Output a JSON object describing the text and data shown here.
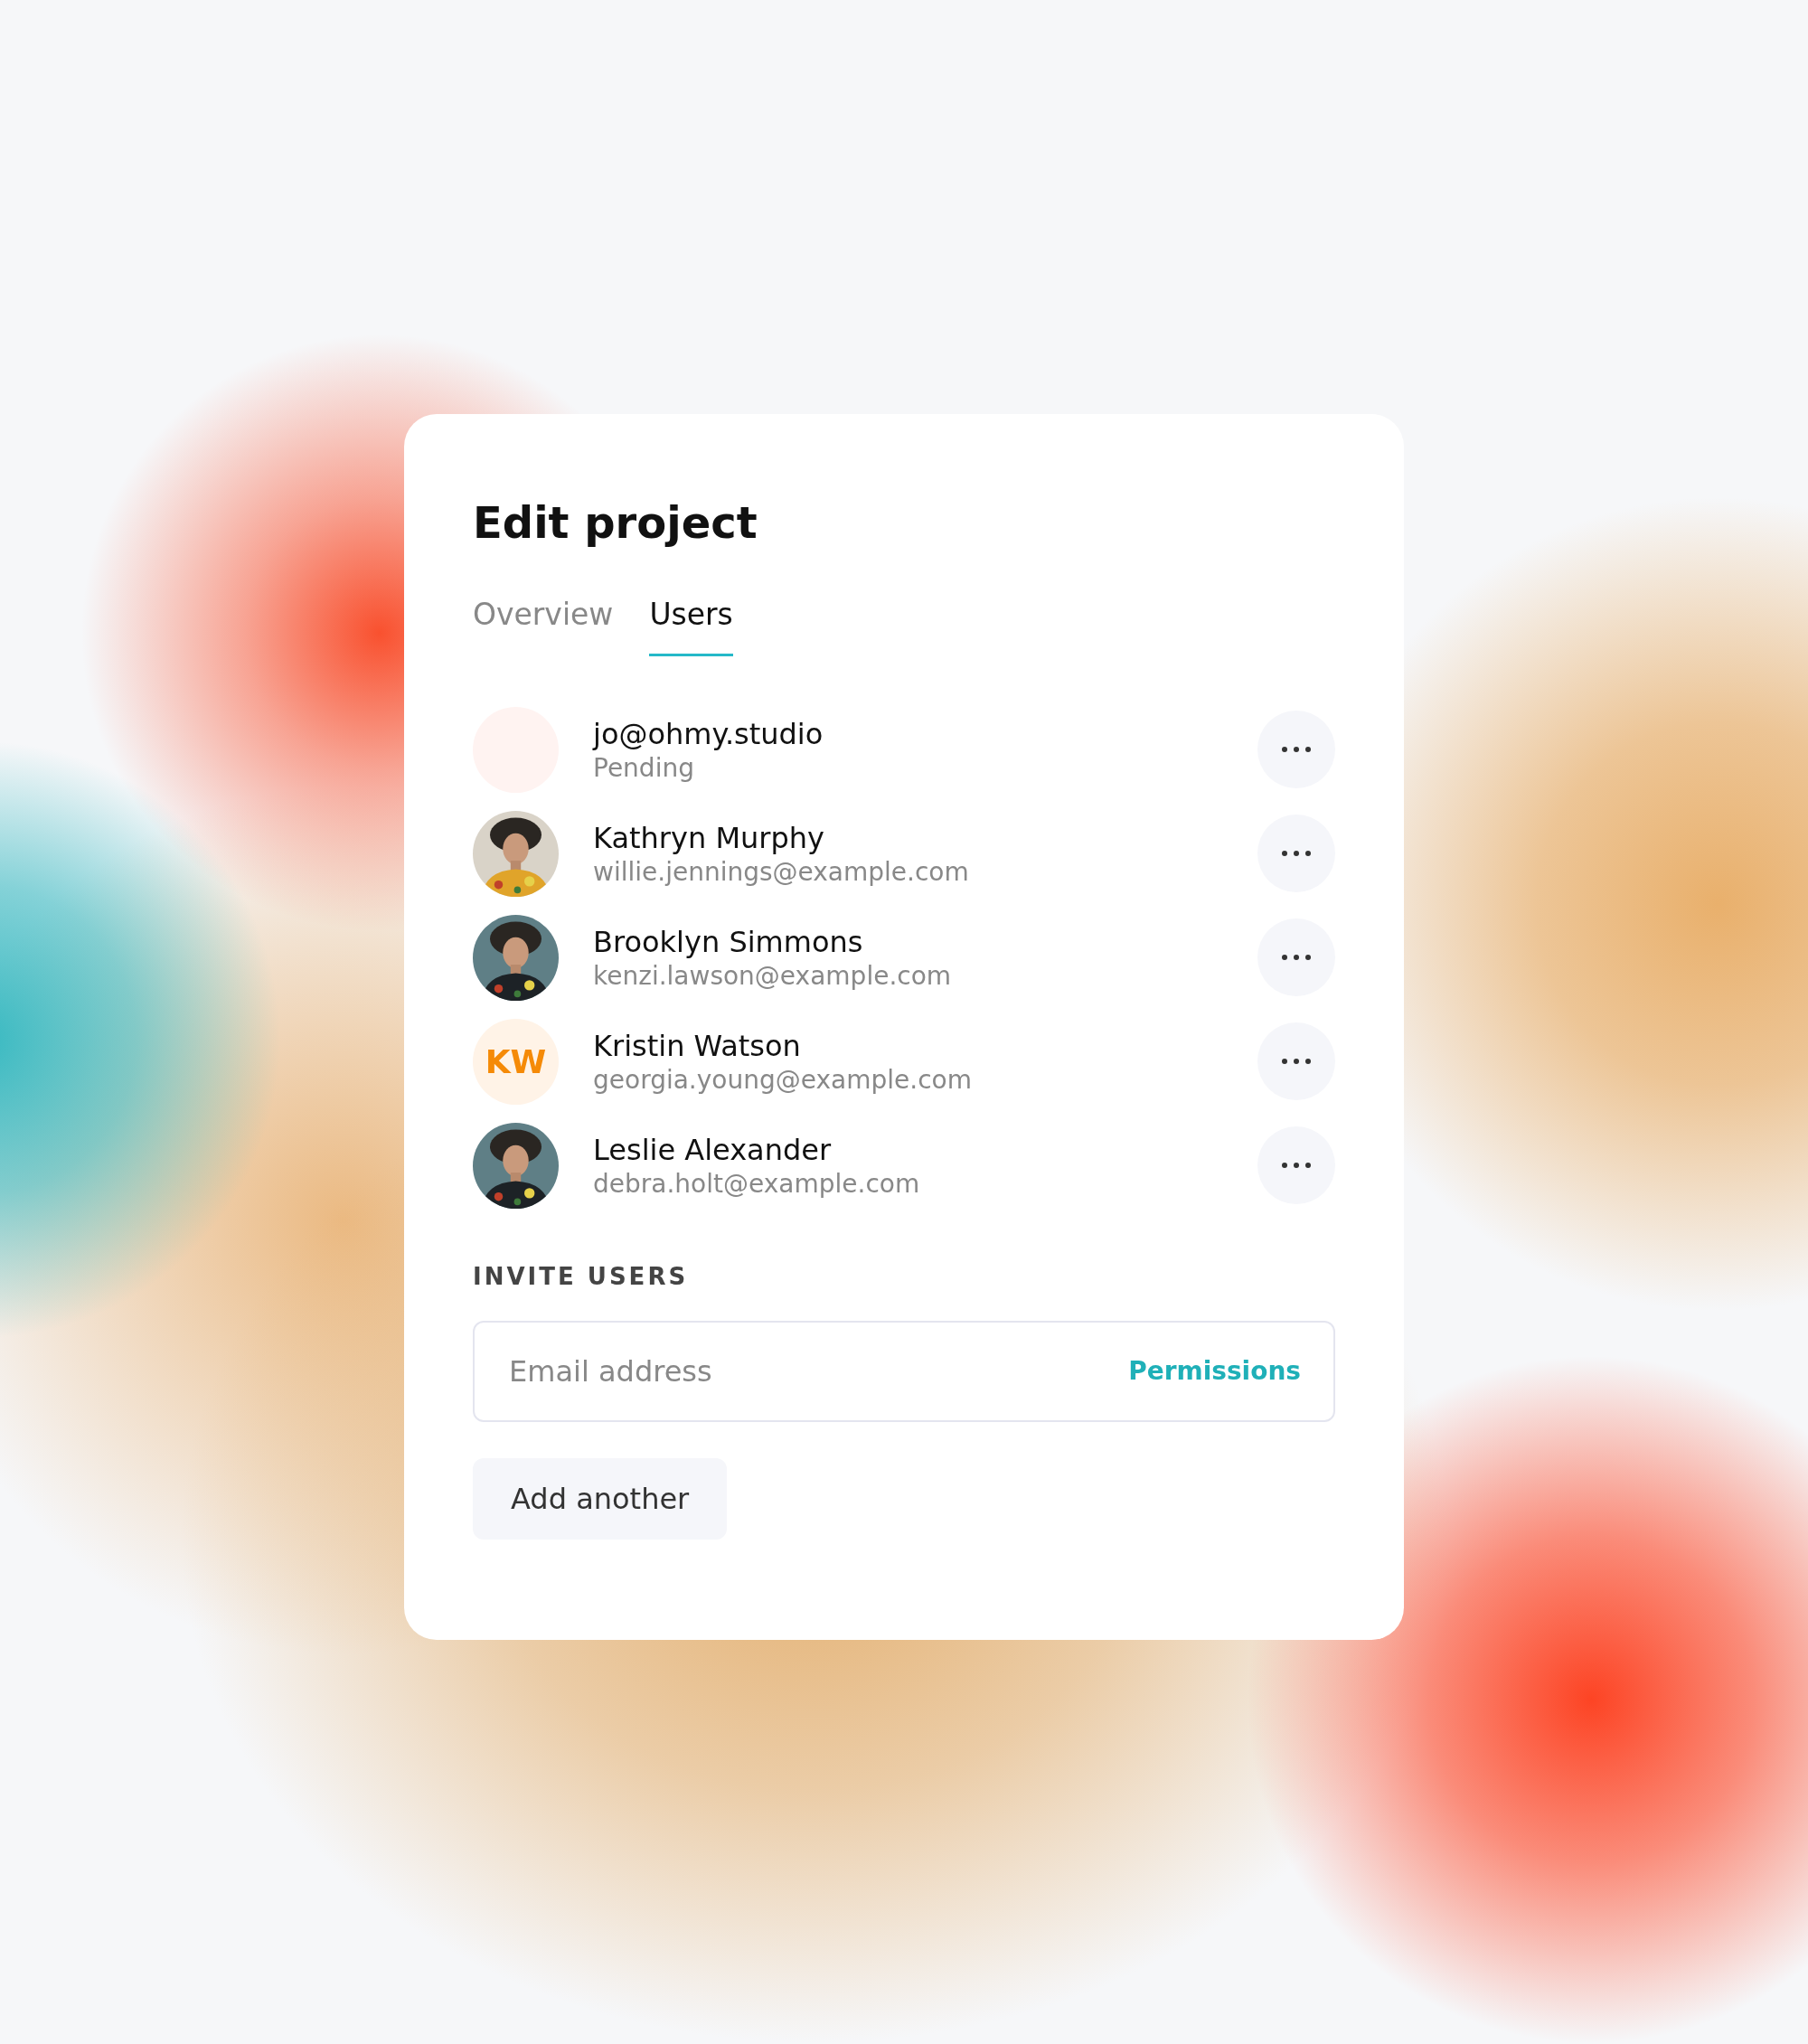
{
  "title": "Edit project",
  "tabs": [
    {
      "label": "Overview",
      "selected": false
    },
    {
      "label": "Users",
      "selected": true
    }
  ],
  "users": [
    {
      "kind": "blank",
      "name": "jo@ohmy.studio",
      "detail": "Pending"
    },
    {
      "kind": "picture",
      "name": "Kathryn Murphy",
      "detail": "willie.jennings@example.com"
    },
    {
      "kind": "picture",
      "name": "Brooklyn Simmons",
      "detail": "kenzi.lawson@example.com"
    },
    {
      "kind": "initials",
      "initials": "KW",
      "name": "Kristin Watson",
      "detail": "georgia.young@example.com"
    },
    {
      "kind": "picture",
      "name": "Leslie Alexander",
      "detail": "debra.holt@example.com"
    }
  ],
  "invite": {
    "label": "INVITE USERS",
    "placeholder": "Email address",
    "permissions": "Permissions",
    "add_button": "Add another"
  }
}
